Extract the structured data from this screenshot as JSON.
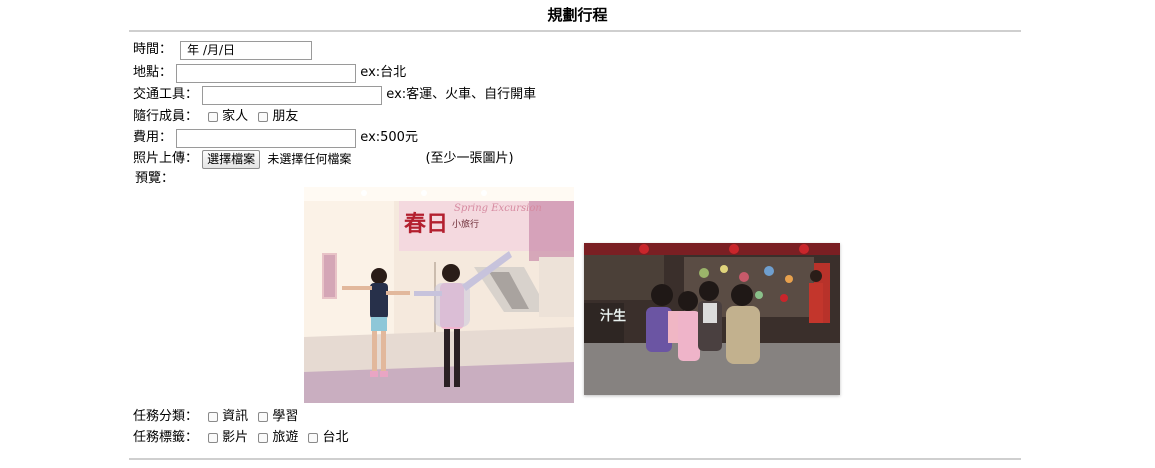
{
  "page_title": "規劃行程",
  "form": {
    "time": {
      "label": "時間：",
      "placeholder": "年 /月/日"
    },
    "place": {
      "label": "地點：",
      "value": "",
      "hint": "ex:台北"
    },
    "transport": {
      "label": "交通工具：",
      "value": "",
      "hint": "ex:客運、火車、自行開車"
    },
    "members": {
      "label": "隨行成員：",
      "options": [
        "家人",
        "朋友"
      ]
    },
    "cost": {
      "label": "費用：",
      "value": "",
      "hint": "ex:500元"
    },
    "photo_upload": {
      "label": "照片上傳：",
      "button_label": "選擇檔案",
      "status": "未選擇任何檔案",
      "note": "(至少一張圖片)"
    },
    "preview": {
      "label": "預覽："
    },
    "photo1": {
      "banner_text": "春日",
      "banner_sub": "小旅行",
      "banner_en": "Spring Excursion"
    },
    "photo2": {
      "sign_text": "汁生"
    },
    "task_category": {
      "label": "任務分類：",
      "options": [
        "資訊",
        "學習"
      ]
    },
    "task_tags": {
      "label": "任務標籤：",
      "options": [
        "影片",
        "旅遊",
        "台北"
      ]
    }
  }
}
